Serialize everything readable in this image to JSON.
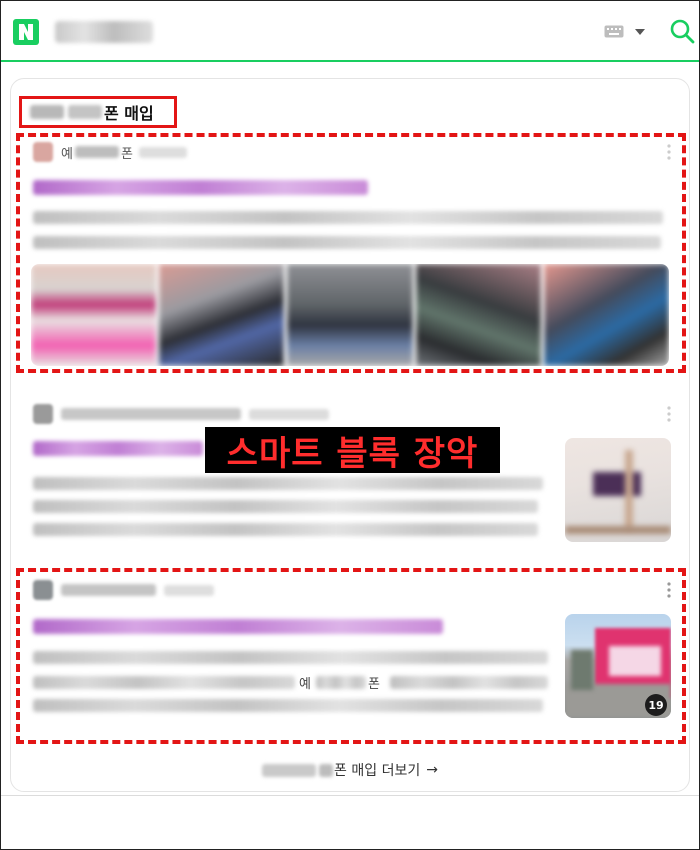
{
  "header": {
    "logo_icon": "naver-n-logo",
    "keyboard_icon": "keyboard-icon",
    "dropdown_icon": "caret-down-icon",
    "search_icon": "search-icon",
    "brand_color": "#19ce60"
  },
  "card": {
    "title_suffix": "폰 매입",
    "posts": [
      {
        "author_prefix": "예",
        "author_suffix": "폰"
      },
      {
        "overlay_text": "스마트 블록 장악"
      },
      {
        "inline_text_left": "예",
        "inline_text_right": "폰",
        "image_count": "19"
      }
    ],
    "more_link_suffix": "폰 매입 더보기",
    "more_link_arrow": "→"
  },
  "colors": {
    "highlight_red": "#e31515",
    "overlay_text": "#ff2d2d"
  }
}
